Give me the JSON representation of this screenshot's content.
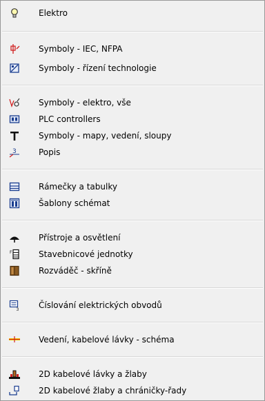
{
  "menu": {
    "items": [
      {
        "label": "Elektro",
        "icon": "lightbulb-icon"
      },
      {
        "label": "Symboly - IEC, NFPA",
        "icon": "iec-symbol-icon"
      },
      {
        "label": "Symboly - řízení technologie",
        "icon": "control-technology-icon"
      },
      {
        "label": "Symboly - elektro, vše",
        "icon": "switch-symbol-icon"
      },
      {
        "label": "PLC controllers",
        "icon": "plc-icon"
      },
      {
        "label": "Symboly - mapy, vedení, sloupy",
        "icon": "pole-icon"
      },
      {
        "label": "Popis",
        "icon": "annotation-icon"
      },
      {
        "label": "Rámečky a tabulky",
        "icon": "frame-table-icon"
      },
      {
        "label": "Šablony schémat",
        "icon": "schema-template-icon"
      },
      {
        "label": "Přístroje a osvětlení",
        "icon": "lamp-icon"
      },
      {
        "label": "Stavebnicové jednotky",
        "icon": "modular-unit-icon"
      },
      {
        "label": "Rozváděč - skříně",
        "icon": "cabinet-icon"
      },
      {
        "label": "Číslování elektrických obvodů",
        "icon": "circuit-numbering-icon"
      },
      {
        "label": "Vedení, kabelové lávky - schéma",
        "icon": "cable-line-icon"
      },
      {
        "label": "2D kabelové lávky a žlaby",
        "icon": "cable-tray-icon"
      },
      {
        "label": "2D kabelové žlaby a chráničky-řady",
        "icon": "cable-conduit-icon"
      }
    ]
  },
  "colors": {
    "menu_background": "#f0f0f0",
    "border": "#979797",
    "icon_red": "#d02020",
    "icon_blue": "#1a3d8f",
    "icon_yellow": "#f2c200"
  }
}
